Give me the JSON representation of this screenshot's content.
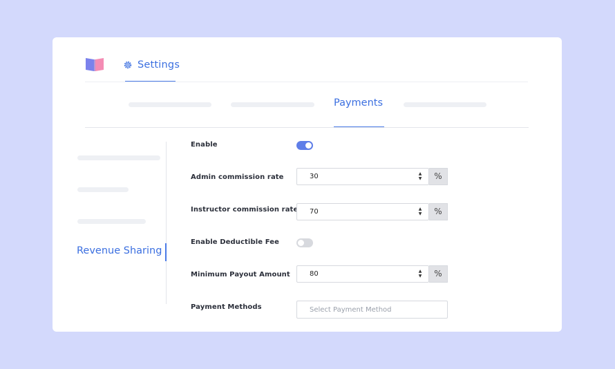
{
  "header": {
    "logo_icon": "book-logo-icon",
    "settings_icon": "gear-icon",
    "settings_label": "Settings"
  },
  "tabs": {
    "active_label": "Payments"
  },
  "sidebar": {
    "active_label": "Revenue Sharing"
  },
  "form": {
    "enable": {
      "label": "Enable",
      "state": "on"
    },
    "admin_commission": {
      "label": "Admin commission rate",
      "value": "30",
      "unit": "%"
    },
    "instructor_commission": {
      "label": "Instructor commission rate",
      "value": "70",
      "unit": "%"
    },
    "deductible_fee": {
      "label": "Enable Deductible Fee",
      "state": "off"
    },
    "minimum_payout": {
      "label": "Minimum Payout Amount",
      "value": "80",
      "unit": "%"
    },
    "payment_methods": {
      "label": "Payment Methods",
      "placeholder": "Select Payment Method"
    }
  },
  "colors": {
    "accent": "#3b6fe0",
    "background": "#d3d9fc",
    "toggle_on": "#5f7ee8",
    "toggle_off": "#d7d9de"
  }
}
